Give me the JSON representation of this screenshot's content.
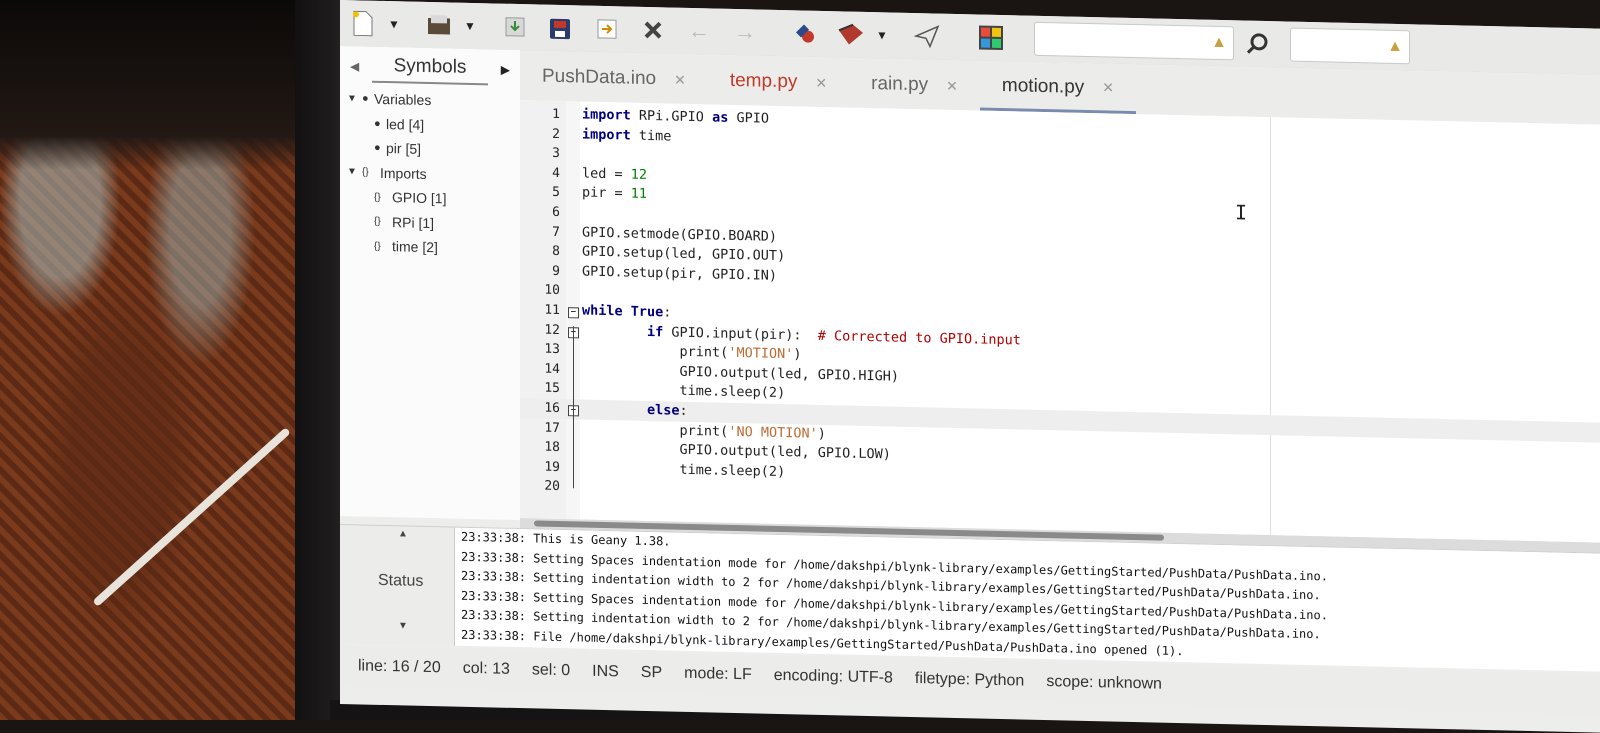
{
  "toolbar": {
    "buttons": [
      "new-file-icon",
      "open-file-icon",
      "save-icon",
      "save-all-icon",
      "revert-icon",
      "close-icon",
      "back-arrow-icon",
      "forward-arrow-icon",
      "compile-icon",
      "build-icon",
      "run-icon",
      "color-chooser-icon",
      "search-icon"
    ],
    "search_value": "",
    "goto_value": ""
  },
  "sidebar": {
    "tab_label": "Symbols",
    "tree": [
      {
        "label": "Variables",
        "level": 0,
        "type": "group"
      },
      {
        "label": "led [4]",
        "level": 1,
        "type": "var"
      },
      {
        "label": "pir [5]",
        "level": 1,
        "type": "var"
      },
      {
        "label": "Imports",
        "level": 0,
        "type": "group-import"
      },
      {
        "label": "GPIO [1]",
        "level": 1,
        "type": "import"
      },
      {
        "label": "RPi [1]",
        "level": 1,
        "type": "import"
      },
      {
        "label": "time [2]",
        "level": 1,
        "type": "import"
      }
    ]
  },
  "tabs": [
    {
      "label": "PushData.ino",
      "active": false,
      "modified": false
    },
    {
      "label": "temp.py",
      "active": false,
      "modified": true
    },
    {
      "label": "rain.py",
      "active": false,
      "modified": false
    },
    {
      "label": "motion.py",
      "active": true,
      "modified": false
    }
  ],
  "editor": {
    "current_line": 16,
    "lines": [
      "import RPi.GPIO as GPIO",
      "import time",
      "",
      "led = 12",
      "pir = 11",
      "",
      "GPIO.setmode(GPIO.BOARD)",
      "GPIO.setup(led, GPIO.OUT)",
      "GPIO.setup(pir, GPIO.IN)",
      "",
      "while True:",
      "        if GPIO.input(pir):  # Corrected to GPIO.input",
      "            print('MOTION')",
      "            GPIO.output(led, GPIO.HIGH)",
      "            time.sleep(2)",
      "        else:",
      "            print('NO MOTION')",
      "            GPIO.output(led, GPIO.LOW)",
      "            time.sleep(2)",
      ""
    ]
  },
  "messages": {
    "side_label": "Status",
    "lines": [
      "23:33:38: This is Geany 1.38.",
      "23:33:38: Setting Spaces indentation mode for /home/dakshpi/blynk-library/examples/GettingStarted/PushData/PushData.ino.",
      "23:33:38: Setting indentation width to 2 for /home/dakshpi/blynk-library/examples/GettingStarted/PushData/PushData.ino.",
      "23:33:38: Setting Spaces indentation mode for /home/dakshpi/blynk-library/examples/GettingStarted/PushData/PushData.ino.",
      "23:33:38: Setting indentation width to 2 for /home/dakshpi/blynk-library/examples/GettingStarted/PushData/PushData.ino.",
      "23:33:38: File /home/dakshpi/blynk-library/examples/GettingStarted/PushData/PushData.ino opened (1)."
    ]
  },
  "statusbar": {
    "line": "line: 16 / 20",
    "col": "col: 13",
    "sel": "sel: 0",
    "ins": "INS",
    "sp": "SP",
    "mode": "mode: LF",
    "encoding": "encoding: UTF-8",
    "filetype": "filetype: Python",
    "scope": "scope: unknown"
  }
}
